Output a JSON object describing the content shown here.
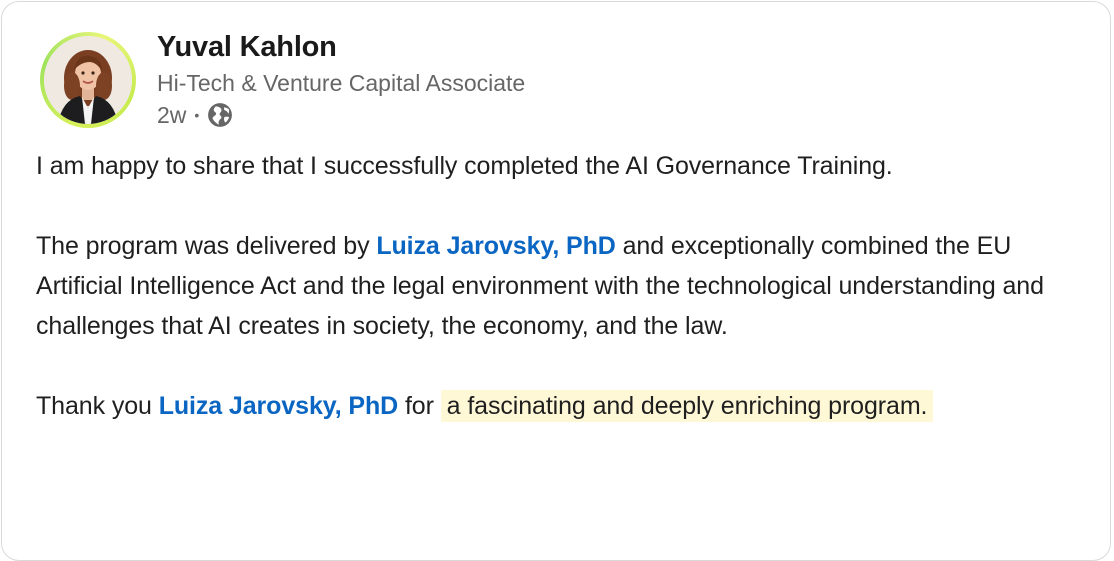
{
  "post": {
    "author": {
      "name": "Yuval Kahlon",
      "headline": "Hi-Tech & Venture Capital Associate",
      "avatar_icon": "profile-photo"
    },
    "meta": {
      "age": "2w",
      "separator": "•",
      "visibility_icon": "globe-icon"
    },
    "paragraph_1": "I am happy to share that I successfully completed the AI Governance Training.",
    "paragraph_2": {
      "before": "The program was delivered by ",
      "mention": "Luiza Jarovsky, PhD",
      "after": " and exceptionally combined the EU Artificial Intelligence Act and the legal environment with the technological understanding and challenges that AI creates in society, the economy, and the law."
    },
    "paragraph_3": {
      "before": "Thank you ",
      "mention": "Luiza Jarovsky, PhD",
      "middle": " for ",
      "highlight": "a fascinating and deeply enriching program."
    }
  },
  "colors": {
    "mention": "#0a66c2",
    "highlight_bg": "#fff8d6",
    "avatar_ring": "#c7ec4f",
    "secondary_text": "#666666"
  }
}
